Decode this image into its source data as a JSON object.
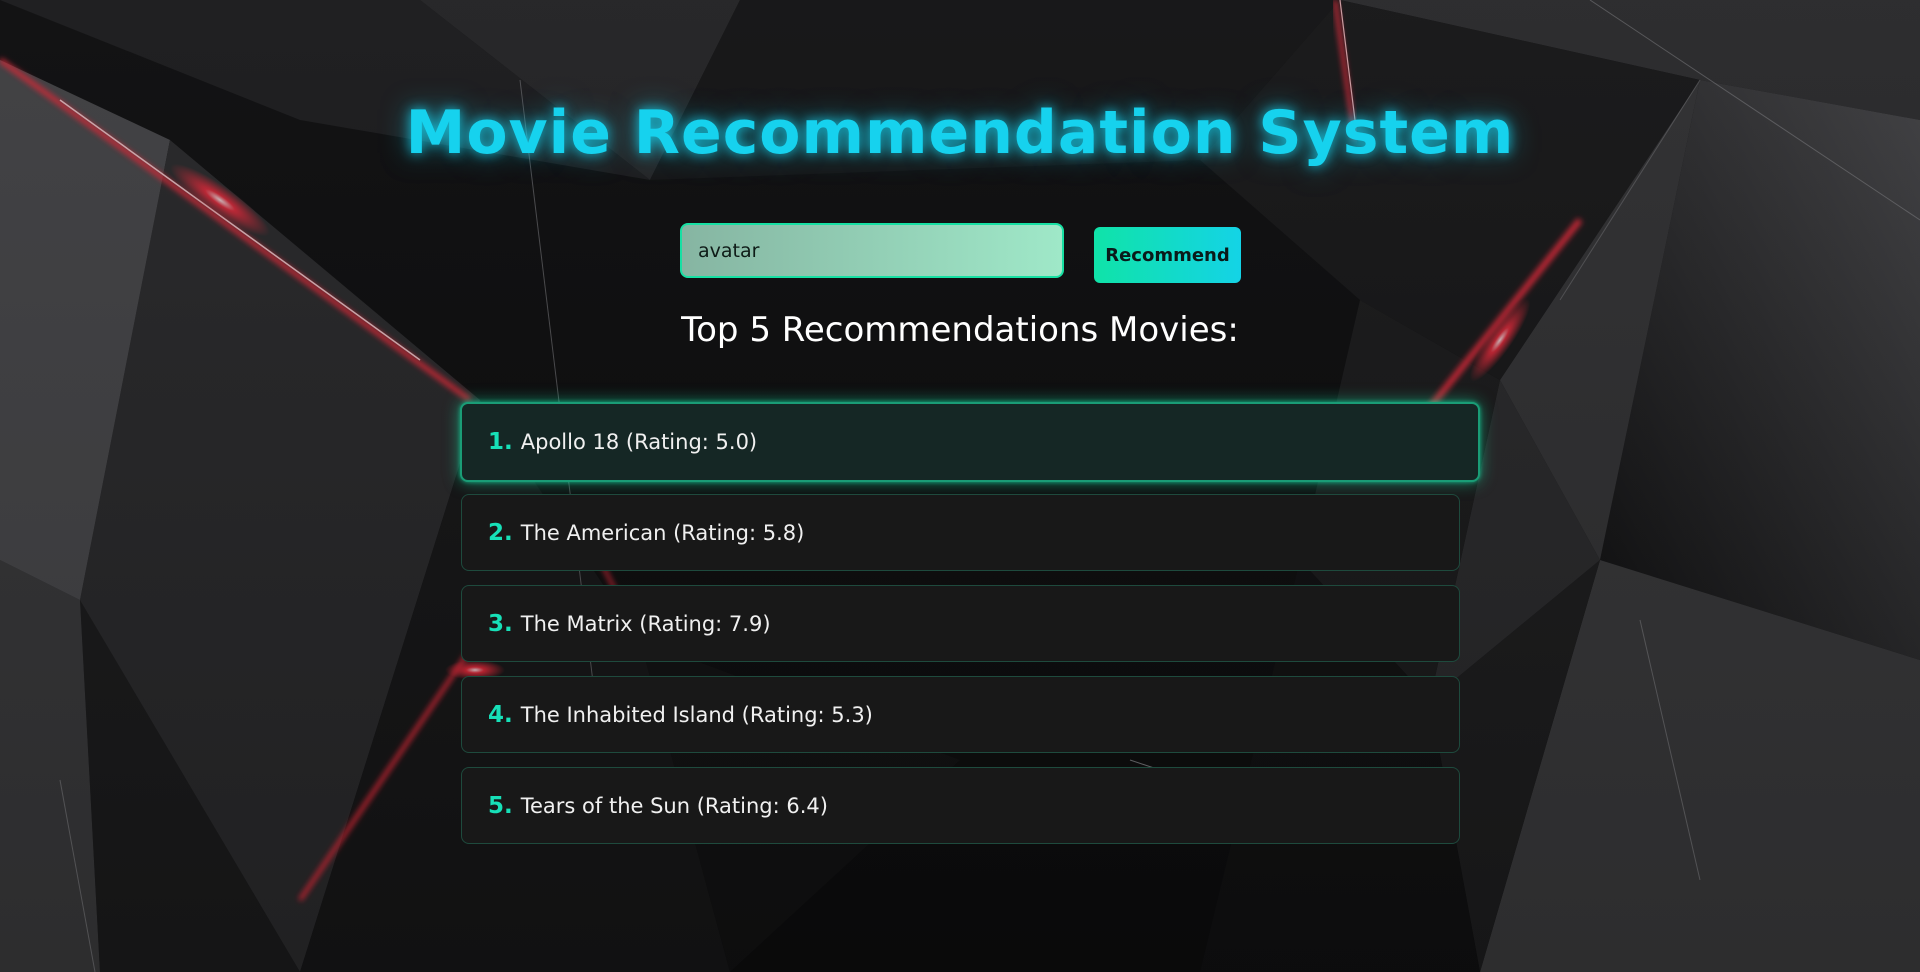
{
  "app": {
    "title": "Movie Recommendation System"
  },
  "search": {
    "value": "avatar",
    "button_label": "Recommend"
  },
  "results": {
    "heading": "Top 5 Recommendations Movies:",
    "items": [
      {
        "number": "1.",
        "text": "Apollo 18 (Rating: 5.0)",
        "active": true
      },
      {
        "number": "2.",
        "text": "The American (Rating: 5.8)",
        "active": false
      },
      {
        "number": "3.",
        "text": "The Matrix (Rating: 7.9)",
        "active": false
      },
      {
        "number": "4.",
        "text": "The Inhabited Island (Rating: 5.3)",
        "active": false
      },
      {
        "number": "5.",
        "text": "Tears of the Sun (Rating: 6.4)",
        "active": false
      }
    ]
  },
  "colors": {
    "accent": "#16d2ee",
    "accent_green": "#17e0b8",
    "background": "#0b0b0c",
    "glow_red": "#ff2a3d"
  }
}
